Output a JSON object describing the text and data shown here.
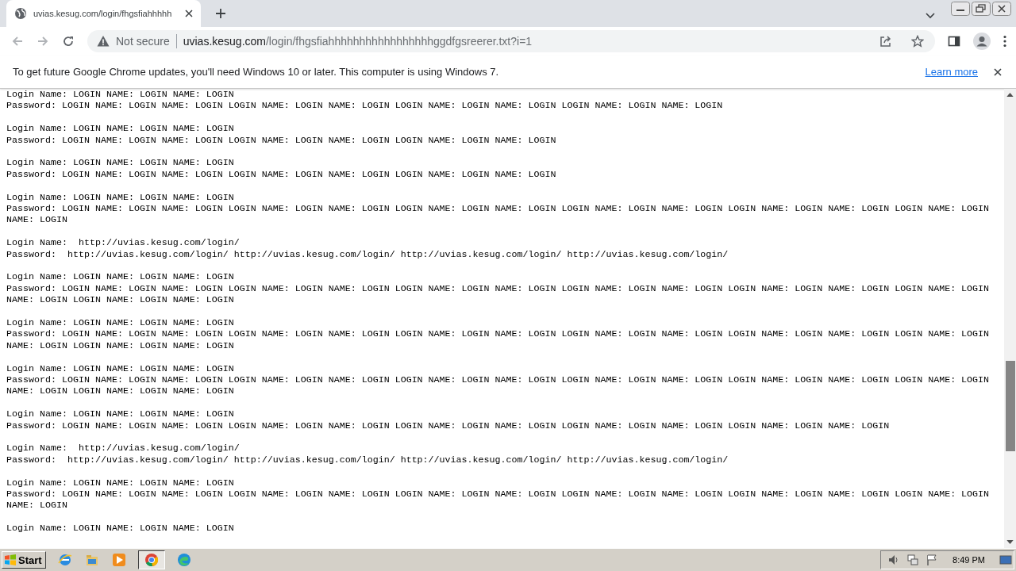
{
  "tab": {
    "title": "uvias.kesug.com/login/fhgsfiahhhhh"
  },
  "address_bar": {
    "security": "Not secure",
    "host": "uvias.kesug.com",
    "path": "/login/fhgsfiahhhhhhhhhhhhhhhhhggdfgsreerer.txt?i=1"
  },
  "infobar": {
    "message": "To get future Google Chrome updates, you'll need Windows 10 or later. This computer is using Windows 7.",
    "link": "Learn more"
  },
  "records": [
    {
      "login": "Login Name: LOGIN NAME: LOGIN NAME: LOGIN",
      "password": "Password: LOGIN NAME: LOGIN NAME: LOGIN LOGIN NAME: LOGIN NAME: LOGIN LOGIN NAME: LOGIN NAME: LOGIN LOGIN NAME: LOGIN NAME: LOGIN"
    },
    {
      "login": "Login Name: LOGIN NAME: LOGIN NAME: LOGIN",
      "password": "Password: LOGIN NAME: LOGIN NAME: LOGIN LOGIN NAME: LOGIN NAME: LOGIN LOGIN NAME: LOGIN NAME: LOGIN"
    },
    {
      "login": "Login Name: LOGIN NAME: LOGIN NAME: LOGIN",
      "password": "Password: LOGIN NAME: LOGIN NAME: LOGIN LOGIN NAME: LOGIN NAME: LOGIN LOGIN NAME: LOGIN NAME: LOGIN"
    },
    {
      "login": "Login Name: LOGIN NAME: LOGIN NAME: LOGIN",
      "password": "Password: LOGIN NAME: LOGIN NAME: LOGIN LOGIN NAME: LOGIN NAME: LOGIN LOGIN NAME: LOGIN NAME: LOGIN LOGIN NAME: LOGIN NAME: LOGIN LOGIN NAME: LOGIN NAME: LOGIN LOGIN NAME: LOGIN NAME: LOGIN"
    },
    {
      "login": "Login Name:  http://uvias.kesug.com/login/",
      "password": "Password:  http://uvias.kesug.com/login/ http://uvias.kesug.com/login/ http://uvias.kesug.com/login/ http://uvias.kesug.com/login/"
    },
    {
      "login": "Login Name: LOGIN NAME: LOGIN NAME: LOGIN",
      "password": "Password: LOGIN NAME: LOGIN NAME: LOGIN LOGIN NAME: LOGIN NAME: LOGIN LOGIN NAME: LOGIN NAME: LOGIN LOGIN NAME: LOGIN NAME: LOGIN LOGIN NAME: LOGIN NAME: LOGIN LOGIN NAME: LOGIN NAME: LOGIN LOGIN NAME: LOGIN NAME: LOGIN"
    },
    {
      "login": "Login Name: LOGIN NAME: LOGIN NAME: LOGIN",
      "password": "Password: LOGIN NAME: LOGIN NAME: LOGIN LOGIN NAME: LOGIN NAME: LOGIN LOGIN NAME: LOGIN NAME: LOGIN LOGIN NAME: LOGIN NAME: LOGIN LOGIN NAME: LOGIN NAME: LOGIN LOGIN NAME: LOGIN NAME: LOGIN LOGIN NAME: LOGIN NAME: LOGIN"
    },
    {
      "login": "Login Name: LOGIN NAME: LOGIN NAME: LOGIN",
      "password": "Password: LOGIN NAME: LOGIN NAME: LOGIN LOGIN NAME: LOGIN NAME: LOGIN LOGIN NAME: LOGIN NAME: LOGIN LOGIN NAME: LOGIN NAME: LOGIN LOGIN NAME: LOGIN NAME: LOGIN LOGIN NAME: LOGIN NAME: LOGIN LOGIN NAME: LOGIN NAME: LOGIN"
    },
    {
      "login": "Login Name: LOGIN NAME: LOGIN NAME: LOGIN",
      "password": "Password: LOGIN NAME: LOGIN NAME: LOGIN LOGIN NAME: LOGIN NAME: LOGIN LOGIN NAME: LOGIN NAME: LOGIN LOGIN NAME: LOGIN NAME: LOGIN LOGIN NAME: LOGIN NAME: LOGIN"
    },
    {
      "login": "Login Name:  http://uvias.kesug.com/login/",
      "password": "Password:  http://uvias.kesug.com/login/ http://uvias.kesug.com/login/ http://uvias.kesug.com/login/ http://uvias.kesug.com/login/"
    },
    {
      "login": "Login Name: LOGIN NAME: LOGIN NAME: LOGIN",
      "password": "Password: LOGIN NAME: LOGIN NAME: LOGIN LOGIN NAME: LOGIN NAME: LOGIN LOGIN NAME: LOGIN NAME: LOGIN LOGIN NAME: LOGIN NAME: LOGIN LOGIN NAME: LOGIN NAME: LOGIN LOGIN NAME: LOGIN NAME: LOGIN"
    },
    {
      "login": "Login Name: LOGIN NAME: LOGIN NAME: LOGIN"
    }
  ],
  "taskbar": {
    "start": "Start",
    "clock": "8:49 PM"
  }
}
